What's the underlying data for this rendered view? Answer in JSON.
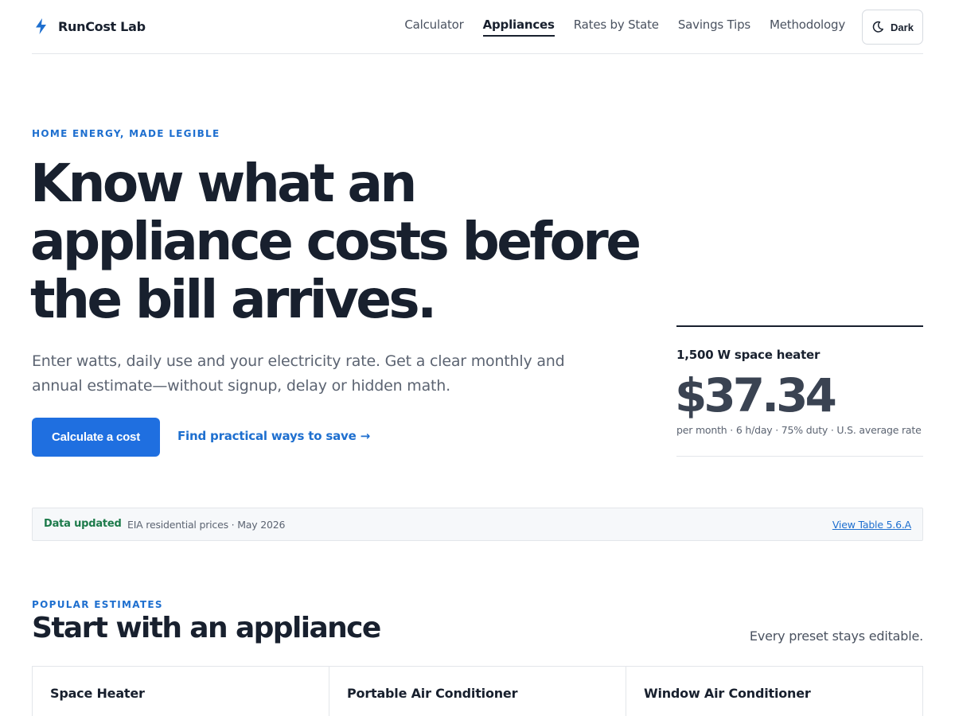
{
  "brand": {
    "name": "RunCost Lab",
    "icon": "lightning-bolt-icon",
    "accent": "#1e6fcf"
  },
  "nav": {
    "items": [
      {
        "label": "Calculator",
        "active": false
      },
      {
        "label": "Appliances",
        "active": true
      },
      {
        "label": "Rates by State",
        "active": false
      },
      {
        "label": "Savings Tips",
        "active": false
      },
      {
        "label": "Methodology",
        "active": false
      }
    ],
    "theme_toggle": {
      "label": "Dark",
      "icon": "moon-icon"
    }
  },
  "hero": {
    "eyebrow": "HOME ENERGY, MADE LEGIBLE",
    "title": "Know what an appliance costs before the bill arrives.",
    "subtitle": "Enter watts, daily use and your electricity rate. Get a clear monthly and annual estimate—without signup, delay or hidden math.",
    "primary_cta": "Calculate a cost",
    "secondary_cta": "Find practical ways to save →"
  },
  "estimate": {
    "label": "1,500 W space heater",
    "value": "$37.34",
    "meta": "per month · 6 h/day · 75% duty · U.S. average rate"
  },
  "data_bar": {
    "label": "Data updated",
    "text": "EIA residential prices · May 2026",
    "link": "View Table 5.6.A"
  },
  "popular": {
    "eyebrow": "POPULAR ESTIMATES",
    "title": "Start with an appliance",
    "note": "Every preset stays editable.",
    "cards": [
      {
        "title": "Space Heater"
      },
      {
        "title": "Portable Air Conditioner"
      },
      {
        "title": "Window Air Conditioner"
      }
    ]
  },
  "colors": {
    "primary": "#1f6fe0",
    "success": "#1c7a4a",
    "ink": "#18202e",
    "muted": "#5c6472"
  }
}
